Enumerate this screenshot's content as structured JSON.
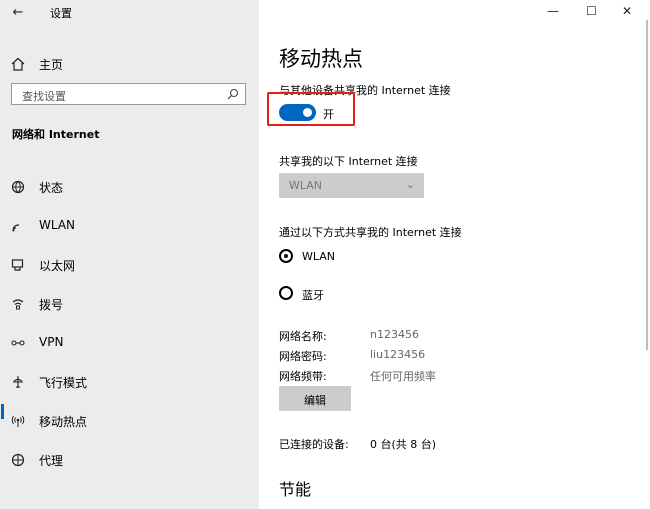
{
  "window": {
    "title": "设置",
    "back_icon": "←",
    "minimize": "—",
    "maximize": "☐",
    "close": "✕"
  },
  "sidebar": {
    "home_label": "主页",
    "search_placeholder": "查找设置",
    "section_title": "网络和 Internet",
    "items": [
      {
        "label": "状态",
        "icon": "status-icon"
      },
      {
        "label": "WLAN",
        "icon": "wlan-icon"
      },
      {
        "label": "以太网",
        "icon": "ethernet-icon"
      },
      {
        "label": "拨号",
        "icon": "dialup-icon"
      },
      {
        "label": "VPN",
        "icon": "vpn-icon"
      },
      {
        "label": "飞行模式",
        "icon": "airplane-icon"
      },
      {
        "label": "移动热点",
        "icon": "hotspot-icon",
        "selected": true
      },
      {
        "label": "代理",
        "icon": "proxy-icon"
      }
    ]
  },
  "main": {
    "title": "移动热点",
    "share_label": "与其他设备共享我的 Internet 连接",
    "toggle_state": "开",
    "share_from_label": "共享我的以下 Internet 连接",
    "share_from_value": "WLAN",
    "share_over_label": "通过以下方式共享我的 Internet 连接",
    "radio_options": [
      "WLAN",
      "蓝牙"
    ],
    "radio_selected": "WLAN",
    "network_name_label": "网络名称:",
    "network_name_value": "n123456",
    "network_password_label": "网络密码:",
    "network_password_value": "liu123456",
    "network_band_label": "网络频带:",
    "network_band_value": "任何可用频率",
    "edit_button": "编辑",
    "connected_label": "已连接的设备:",
    "connected_value": "0 台(共 8 台)",
    "energy_section": "节能"
  },
  "colors": {
    "accent": "#0067c0",
    "highlight_border": "#e02020",
    "sidebar_bg": "#ececec"
  }
}
